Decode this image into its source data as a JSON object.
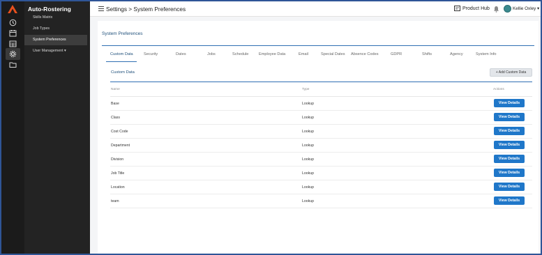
{
  "app": {
    "title": "Auto-Rostering"
  },
  "rail": {
    "icons": [
      "logo-icon",
      "clock-icon",
      "calendar-icon",
      "calendar-grid-icon",
      "gear-icon",
      "folder-icon"
    ]
  },
  "nav": {
    "items": [
      {
        "label": "Skills Matrix"
      },
      {
        "label": "Job Types"
      },
      {
        "label": "System Preferences"
      },
      {
        "label": "User Management ▾"
      }
    ]
  },
  "header": {
    "breadcrumb": "Settings > System Preferences",
    "product_hub": "Product Hub",
    "user_name": "Kellie Oxley",
    "user_caret": "▾"
  },
  "card": {
    "title": "System Preferences"
  },
  "tabs": [
    {
      "label": "Custom Data"
    },
    {
      "label": "Security"
    },
    {
      "label": "Dates"
    },
    {
      "label": "Jobs"
    },
    {
      "label": "Schedule"
    },
    {
      "label": "Employee Data"
    },
    {
      "label": "Email"
    },
    {
      "label": "Special Dates"
    },
    {
      "label": "Absence Codes"
    },
    {
      "label": "GDPR"
    },
    {
      "label": "Shifts"
    },
    {
      "label": "Agency"
    },
    {
      "label": "System Info"
    }
  ],
  "panel": {
    "title": "Custom Data",
    "add_button": "+ Add Custom Data"
  },
  "table": {
    "headers": {
      "name": "Name",
      "type": "Type",
      "actions": "Actions"
    },
    "action_label": "View Details",
    "rows": [
      {
        "name": "Base",
        "type": "Lookup"
      },
      {
        "name": "Class",
        "type": "Lookup"
      },
      {
        "name": "Cost Code",
        "type": "Lookup"
      },
      {
        "name": "Department",
        "type": "Lookup"
      },
      {
        "name": "Division",
        "type": "Lookup"
      },
      {
        "name": "Job Title",
        "type": "Lookup"
      },
      {
        "name": "Location",
        "type": "Lookup"
      },
      {
        "name": "team",
        "type": "Lookup"
      }
    ]
  },
  "colors": {
    "rail": "#1b1b1b",
    "nav": "#232323",
    "accent": "#2f6fb3",
    "button": "#1f77c9",
    "logo": "#e8501e"
  }
}
